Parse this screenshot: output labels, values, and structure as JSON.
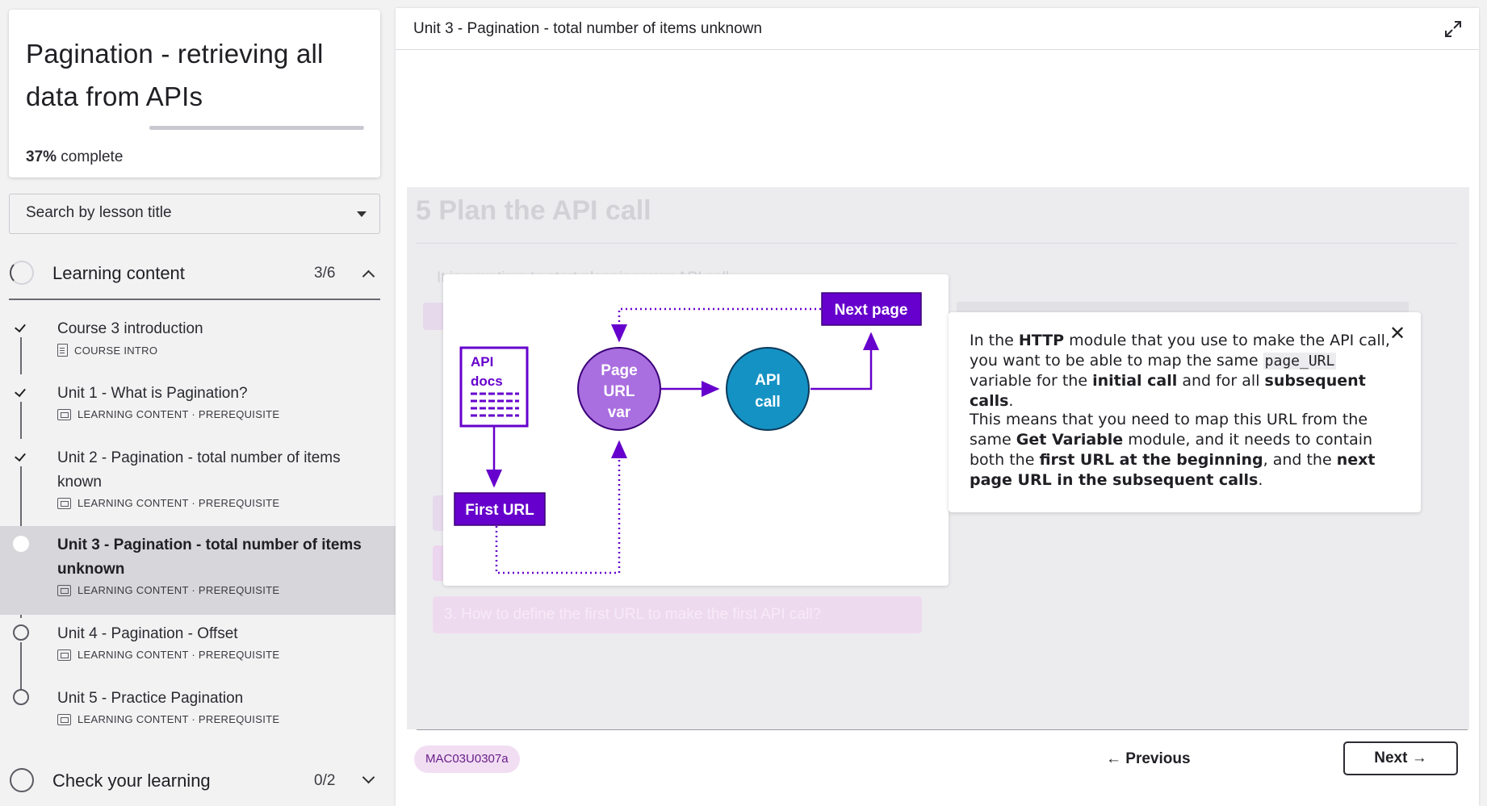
{
  "course": {
    "title_line1": "Pagination - retrieving all",
    "title_line2": "data from APIs",
    "progress_percent": 37,
    "progress_value": "37%",
    "progress_suffix": " complete"
  },
  "search": {
    "placeholder": "Search by lesson title"
  },
  "sections": [
    {
      "label": "Learning content",
      "count": "3/6",
      "expanded": true
    },
    {
      "label": "Check your learning",
      "count": "0/2",
      "expanded": false
    }
  ],
  "lessons": [
    {
      "title": "Course 3 introduction",
      "meta": "COURSE INTRO",
      "status": "complete",
      "icon": "document-icon"
    },
    {
      "title": "Unit 1 - What is Pagination?",
      "meta": "LEARNING CONTENT · PREREQUISITE",
      "status": "complete",
      "icon": "presentation-icon"
    },
    {
      "title": "Unit 2 - Pagination - total number of items known",
      "meta": "LEARNING CONTENT · PREREQUISITE",
      "status": "complete",
      "icon": "presentation-icon"
    },
    {
      "title": "Unit 3 - Pagination - total number of items unknown",
      "meta": "LEARNING CONTENT · PREREQUISITE",
      "status": "current",
      "icon": "presentation-icon"
    },
    {
      "title": "Unit 4 - Pagination - Offset",
      "meta": "LEARNING CONTENT · PREREQUISITE",
      "status": "not-started",
      "icon": "presentation-icon"
    },
    {
      "title": "Unit 5 - Practice Pagination",
      "meta": "LEARNING CONTENT · PREREQUISITE",
      "status": "not-started",
      "icon": "presentation-icon"
    }
  ],
  "main": {
    "title": "Unit 3 - Pagination - total number of items unknown",
    "step_heading": "5 Plan the API call",
    "intro_text": "It is now time to start planning your API call.",
    "question_3": "3. How to define the first URL to make the first API call?"
  },
  "diagram": {
    "api_docs_line1": "API",
    "api_docs_line2": "docs",
    "first_url": "First URL",
    "page_url_line1": "Page",
    "page_url_line2": "URL",
    "page_url_line3": "var",
    "api_call_line1": "API",
    "api_call_line2": "call",
    "next_page": "Next page"
  },
  "tooltip": {
    "p1_a": "In the ",
    "p1_b": "HTTP",
    "p1_c": " module that you use to make the API call, you want to be able to map the same ",
    "p1_code": "page_URL",
    "p1_d": " variable for the ",
    "p1_e": "initial call",
    "p1_f": " and for all ",
    "p1_g": "subsequent calls",
    "p1_h": ".",
    "p2_a": "This means that you need to map this URL from the same ",
    "p2_b": "Get Variable",
    "p2_c": " module, and it needs to contain both the ",
    "p2_d": "first URL at the beginning",
    "p2_e": ", and the ",
    "p2_f": "next page URL in the subsequent calls",
    "p2_g": "."
  },
  "footer": {
    "code_badge": "MAC03U0307a",
    "previous_label": "← Previous",
    "next_label": "Next →"
  },
  "colors": {
    "purple_dark": "#6600cc",
    "purple_light": "#a96ee0",
    "blue": "#1592c4",
    "badge_bg": "#f1def3"
  }
}
